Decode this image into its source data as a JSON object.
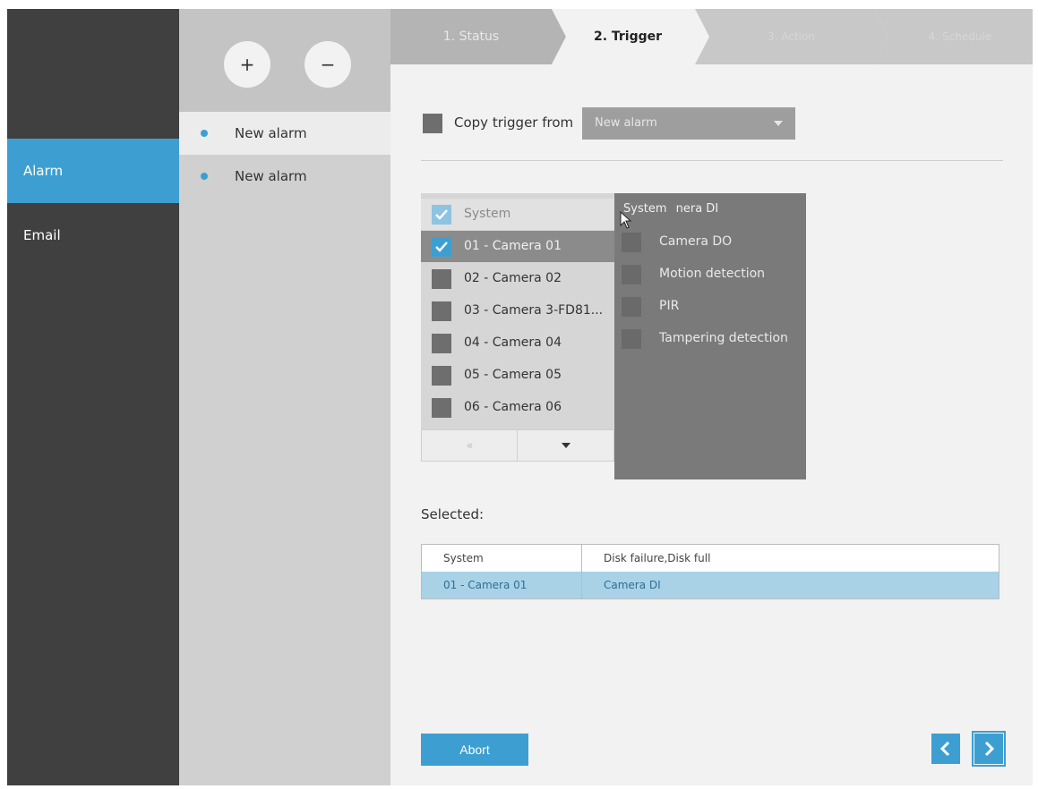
{
  "nav": {
    "items": [
      {
        "label": "Alarm",
        "active": true
      },
      {
        "label": "Email",
        "active": false
      }
    ]
  },
  "alarm_list": {
    "add_symbol": "+",
    "remove_symbol": "−",
    "items": [
      {
        "label": "New alarm",
        "active": true
      },
      {
        "label": "New alarm",
        "active": false
      }
    ]
  },
  "wizard": {
    "steps": [
      {
        "label": "1. Status",
        "state": "done"
      },
      {
        "label": "2. Trigger",
        "state": "active"
      },
      {
        "label": "3. Action",
        "state": "future"
      },
      {
        "label": "4. Schedule",
        "state": "future"
      }
    ]
  },
  "copy_trigger": {
    "label": "Copy trigger from",
    "selected": "New alarm"
  },
  "camera_list": {
    "header": "System",
    "rows": [
      {
        "label": "01 - Camera 01",
        "checked": true
      },
      {
        "label": "02 - Camera 02",
        "checked": false
      },
      {
        "label": "03 - Camera 3-FD81...",
        "checked": false
      },
      {
        "label": "04 - Camera 04",
        "checked": false
      },
      {
        "label": "05 - Camera 05",
        "checked": false
      },
      {
        "label": "06 - Camera 06",
        "checked": false
      }
    ],
    "prev_label": "«"
  },
  "event_dropdown": {
    "header_system": "System",
    "header_text": "nera DI",
    "rows": [
      {
        "label": "Camera DO"
      },
      {
        "label": "Motion detection"
      },
      {
        "label": "PIR"
      },
      {
        "label": "Tampering detection"
      }
    ]
  },
  "selected": {
    "label": "Selected:",
    "rows": [
      {
        "source": "System",
        "events": "Disk failure,Disk full"
      },
      {
        "source": "01 - Camera 01",
        "events": "Camera DI"
      }
    ]
  },
  "footer": {
    "abort_label": "Abort"
  },
  "colors": {
    "accent": "#3d9fd1",
    "nav_bg": "#404040"
  }
}
